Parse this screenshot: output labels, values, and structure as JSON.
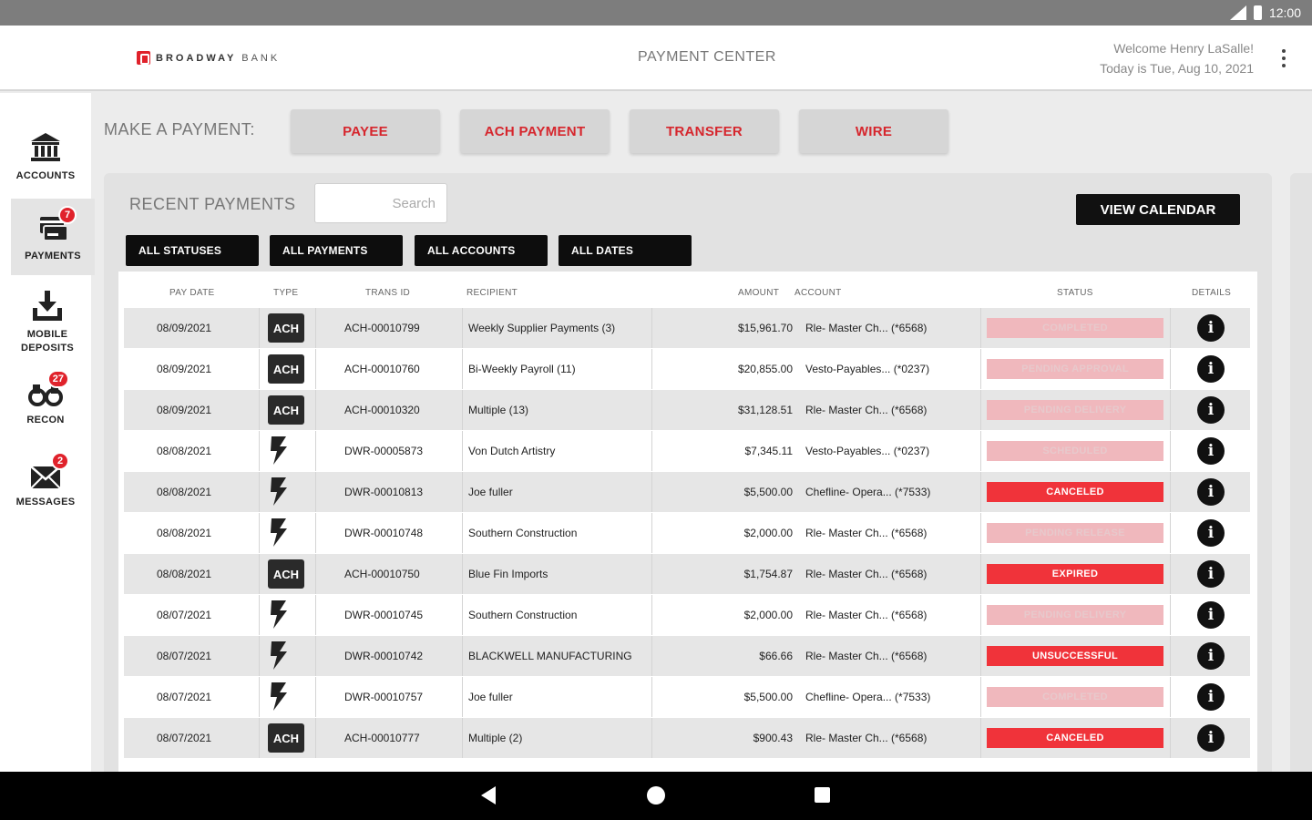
{
  "statusbar": {
    "time": "12:00"
  },
  "header": {
    "logo_brand": "BROADWAY",
    "logo_suffix": "BANK",
    "title": "PAYMENT CENTER",
    "welcome": "Welcome Henry LaSalle!",
    "date": "Today is Tue, Aug 10, 2021"
  },
  "sidebar": {
    "items": [
      {
        "label": "ACCOUNTS",
        "icon": "bank-icon",
        "badge": ""
      },
      {
        "label": "PAYMENTS",
        "icon": "payments-icon",
        "badge": "7"
      },
      {
        "label": "MOBILE DEPOSITS",
        "icon": "deposit-icon",
        "badge": ""
      },
      {
        "label": "RECON",
        "icon": "binoculars-icon",
        "badge": "27"
      },
      {
        "label": "MESSAGES",
        "icon": "envelope-icon",
        "badge": "2"
      }
    ]
  },
  "make_payment": {
    "label": "MAKE A PAYMENT:",
    "buttons": [
      "PAYEE",
      "ACH PAYMENT",
      "TRANSFER",
      "WIRE"
    ]
  },
  "recent": {
    "title": "RECENT PAYMENTS",
    "search_placeholder": "Search",
    "view_calendar": "VIEW CALENDAR",
    "filters": [
      "ALL STATUSES",
      "ALL PAYMENTS",
      "ALL ACCOUNTS",
      "ALL DATES"
    ]
  },
  "table": {
    "columns": [
      "PAY DATE",
      "TYPE",
      "TRANS ID",
      "RECIPIENT",
      "AMOUNT",
      "ACCOUNT",
      "STATUS",
      "DETAILS"
    ],
    "rows": [
      {
        "date": "08/09/2021",
        "type": "ACH",
        "trans_id": "ACH-00010799",
        "recipient": "Weekly Supplier Payments (3)",
        "amount": "$15,961.70",
        "account": "Rle- Master Ch... (*6568)",
        "status": "COMPLETED",
        "status_style": "pink"
      },
      {
        "date": "08/09/2021",
        "type": "ACH",
        "trans_id": "ACH-00010760",
        "recipient": "Bi-Weekly Payroll (11)",
        "amount": "$20,855.00",
        "account": "Vesto-Payables... (*0237)",
        "status": "PENDING APPROVAL",
        "status_style": "pink"
      },
      {
        "date": "08/09/2021",
        "type": "ACH",
        "trans_id": "ACH-00010320",
        "recipient": "Multiple (13)",
        "amount": "$31,128.51",
        "account": "Rle- Master Ch... (*6568)",
        "status": "PENDING DELIVERY",
        "status_style": "pink"
      },
      {
        "date": "08/08/2021",
        "type": "WIRE",
        "trans_id": "DWR-00005873",
        "recipient": "Von Dutch Artistry",
        "amount": "$7,345.11",
        "account": "Vesto-Payables... (*0237)",
        "status": "SCHEDULED",
        "status_style": "pink"
      },
      {
        "date": "08/08/2021",
        "type": "WIRE",
        "trans_id": "DWR-00010813",
        "recipient": "Joe fuller",
        "amount": "$5,500.00",
        "account": "Chefline- Opera... (*7533)",
        "status": "CANCELED",
        "status_style": "red"
      },
      {
        "date": "08/08/2021",
        "type": "WIRE",
        "trans_id": "DWR-00010748",
        "recipient": "Southern Construction",
        "amount": "$2,000.00",
        "account": "Rle- Master Ch... (*6568)",
        "status": "PENDING RELEASE",
        "status_style": "pink"
      },
      {
        "date": "08/08/2021",
        "type": "ACH",
        "trans_id": "ACH-00010750",
        "recipient": "Blue Fin Imports",
        "amount": "$1,754.87",
        "account": "Rle- Master Ch... (*6568)",
        "status": "EXPIRED",
        "status_style": "red"
      },
      {
        "date": "08/07/2021",
        "type": "WIRE",
        "trans_id": "DWR-00010745",
        "recipient": "Southern Construction",
        "amount": "$2,000.00",
        "account": "Rle- Master Ch... (*6568)",
        "status": "PENDING DELIVERY",
        "status_style": "pink"
      },
      {
        "date": "08/07/2021",
        "type": "WIRE",
        "trans_id": "DWR-00010742",
        "recipient": "BLACKWELL MANUFACTURING",
        "amount": "$66.66",
        "account": "Rle- Master Ch... (*6568)",
        "status": "UNSUCCESSFUL",
        "status_style": "red"
      },
      {
        "date": "08/07/2021",
        "type": "WIRE",
        "trans_id": "DWR-00010757",
        "recipient": "Joe fuller",
        "amount": "$5,500.00",
        "account": "Chefline- Opera... (*7533)",
        "status": "COMPLETED",
        "status_style": "pink"
      },
      {
        "date": "08/07/2021",
        "type": "ACH",
        "trans_id": "ACH-00010777",
        "recipient": "Multiple (2)",
        "amount": "$900.43",
        "account": "Rle- Master Ch... (*6568)",
        "status": "CANCELED",
        "status_style": "red"
      }
    ]
  },
  "colors": {
    "accent": "#d6262d",
    "status_red": "#f0333a",
    "status_pink": "#f0b8bd"
  }
}
